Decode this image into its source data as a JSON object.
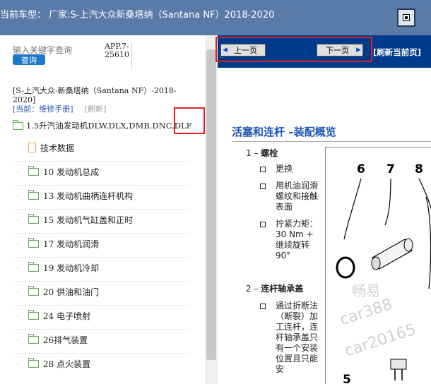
{
  "header": {
    "title": "当前车型： 厂家:S-上汽大众新桑塔纳（Santana NF）2018-2020"
  },
  "sidebar": {
    "search_placeholder": "输入关键字查询",
    "search_button": "查询",
    "app_version": "APP.7-25610",
    "car_name": "[S-上汽大众-新桑塔纳（Santana NF）-2018-2020]",
    "current_label": "[当前：维修手册]",
    "refresh_link": "[刷新]",
    "tree_root": "1.5升汽油发动机DLW,DLX,DMB,DNC,DLF",
    "items": [
      {
        "label": "技术数据",
        "icon": "document-icon"
      },
      {
        "label": "10 发动机总成",
        "icon": "folder-icon"
      },
      {
        "label": "13 发动机曲柄连杆机构",
        "icon": "folder-icon"
      },
      {
        "label": "15 发动机气缸盖和正时",
        "icon": "folder-icon"
      },
      {
        "label": "17 发动机润滑",
        "icon": "folder-icon"
      },
      {
        "label": "19 发动机冷却",
        "icon": "folder-icon"
      },
      {
        "label": "20 供油和油门",
        "icon": "folder-icon"
      },
      {
        "label": "24 电子喷射",
        "icon": "folder-icon"
      },
      {
        "label": "26排气装置",
        "icon": "folder-icon"
      },
      {
        "label": "28 点火装置",
        "icon": "folder-icon"
      }
    ]
  },
  "viewer": {
    "prev_button": "上一页",
    "next_button": "下一页",
    "refresh_current": "[刷新当前页]",
    "doc_title": "活塞和连杆 –装配概览",
    "sections": [
      {
        "num": "1 –",
        "title": "螺栓"
      },
      {
        "num": "2 –",
        "title": "连杆轴承盖"
      }
    ],
    "bullets_1": [
      "更换",
      "用机油润滑螺纹和接触表面",
      "拧紧力矩：30 Nm + 继续旋转 90°"
    ],
    "bullets_2": [
      "通过折断法（断裂）加工连杆，连杆轴承盖只有一个安装位置且只能安"
    ],
    "figure_labels": [
      "6",
      "7",
      "8",
      "5"
    ],
    "watermarks": [
      "畅易",
      "car388",
      "car20165"
    ]
  }
}
